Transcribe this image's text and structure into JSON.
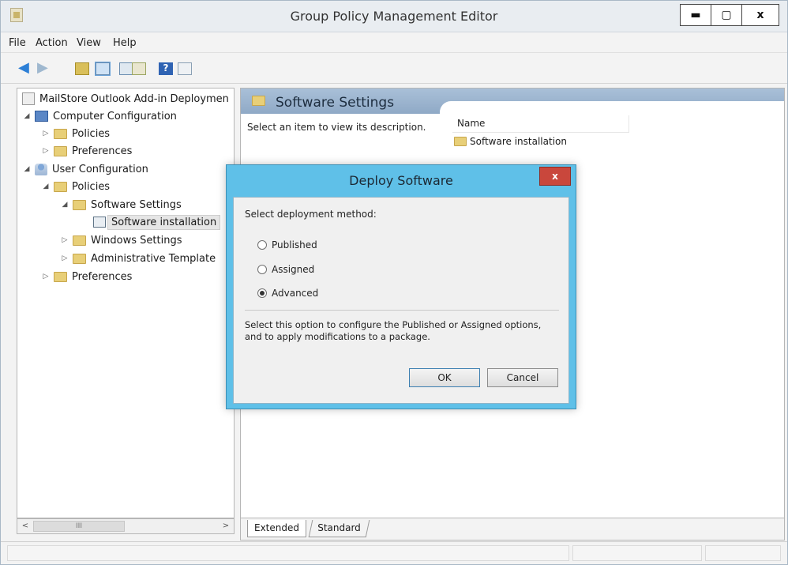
{
  "window": {
    "title": "Group Policy Management Editor",
    "controls": {
      "minimize": "▬",
      "maximize": "▢",
      "close": "x"
    }
  },
  "menu": [
    "File",
    "Action",
    "View",
    "Help"
  ],
  "tree": {
    "root": "MailStore Outlook Add-in Deploymen",
    "computer_configuration": "Computer Configuration",
    "cc_policies": "Policies",
    "cc_preferences": "Preferences",
    "user_configuration": "User Configuration",
    "uc_policies": "Policies",
    "software_settings": "Software Settings",
    "software_installation": "Software installation",
    "windows_settings": "Windows Settings",
    "administrative_templates": "Administrative Template",
    "uc_preferences": "Preferences"
  },
  "right_pane": {
    "header": "Software Settings",
    "description": "Select an item to view its description.",
    "column_name": "Name",
    "items": [
      "Software installation"
    ]
  },
  "tabs": {
    "extended": "Extended",
    "standard": "Standard"
  },
  "dialog": {
    "title": "Deploy Software",
    "close": "x",
    "prompt": "Select deployment method:",
    "options": [
      "Published",
      "Assigned",
      "Advanced"
    ],
    "selected": "Advanced",
    "description": "Select this option to configure the Published or Assigned options, and to apply modifications to a package.",
    "ok": "OK",
    "cancel": "Cancel"
  },
  "colors": {
    "dialog_frame": "#5fc0e8",
    "header_band": "#a9c0d8",
    "close_button": "#c9473c"
  },
  "icons": {
    "back": "back-arrow-icon",
    "forward": "forward-arrow-icon",
    "folder": "folder-icon",
    "help": "help-icon"
  }
}
